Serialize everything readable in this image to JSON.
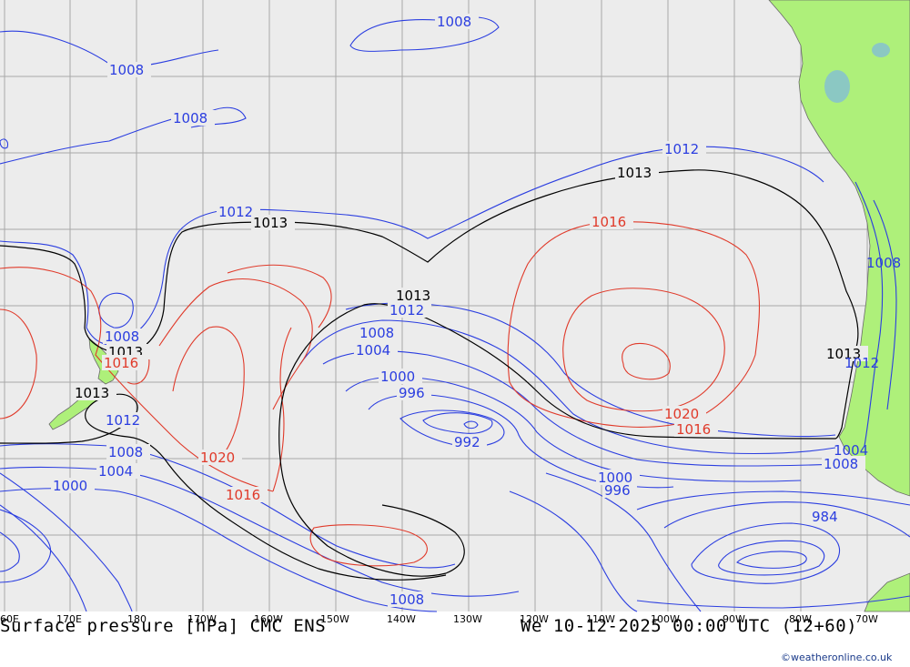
{
  "map": {
    "title": "Surface pressure [hPa] CMC ENS",
    "valid_time": "We 10-12-2025 00:00 UTC (12+60)",
    "credit": "©weatheronline.co.uk",
    "longitude_labels": [
      "60E",
      "170E",
      "180",
      "170W",
      "160W",
      "150W",
      "140W",
      "130W",
      "120W",
      "110W",
      "100W",
      "90W",
      "80W",
      "70W"
    ],
    "colors": {
      "background": "#ececec",
      "grid": "#a8a8a8",
      "land": "#aef07a",
      "low_isobar": "#2b3ee0",
      "high_isobar": "#e03a2a",
      "reference_isobar": "#000000"
    },
    "isobar_labels": {
      "l1008_nw": "1008",
      "l1008_top": "1008",
      "l1008_mid": "1008",
      "l1012_w": "1012",
      "l1012_ne": "1012",
      "l1013_w": "1013",
      "l1013_ne": "1013",
      "l1016_ne": "1016",
      "l1008_c": "1008",
      "l1004_c": "1004",
      "l1000_c": "1000",
      "l996_c": "996",
      "l992_c": "992",
      "l1013_c": "1013",
      "l1012_c": "1012",
      "l1008_nz": "1008",
      "l1013_nz": "1013",
      "l1016_nz": "1016",
      "l1013_nz2": "1013",
      "l1012_nz2": "1012",
      "l1008_sw": "1008",
      "l1004_sw": "1004",
      "l1000_sw": "1000",
      "l1020_sw": "1020",
      "l1016_sw": "1016",
      "l1020_e": "1020",
      "l1016_e": "1016",
      "l1000_se": "1000",
      "l996_se": "996",
      "l1013_chile": "1013",
      "l1012_chile": "1012",
      "l1008_chile": "1008",
      "l1004_chile": "1004",
      "l1008_chile2": "1008",
      "l984_se": "984",
      "l1008_bottom": "1008"
    }
  }
}
